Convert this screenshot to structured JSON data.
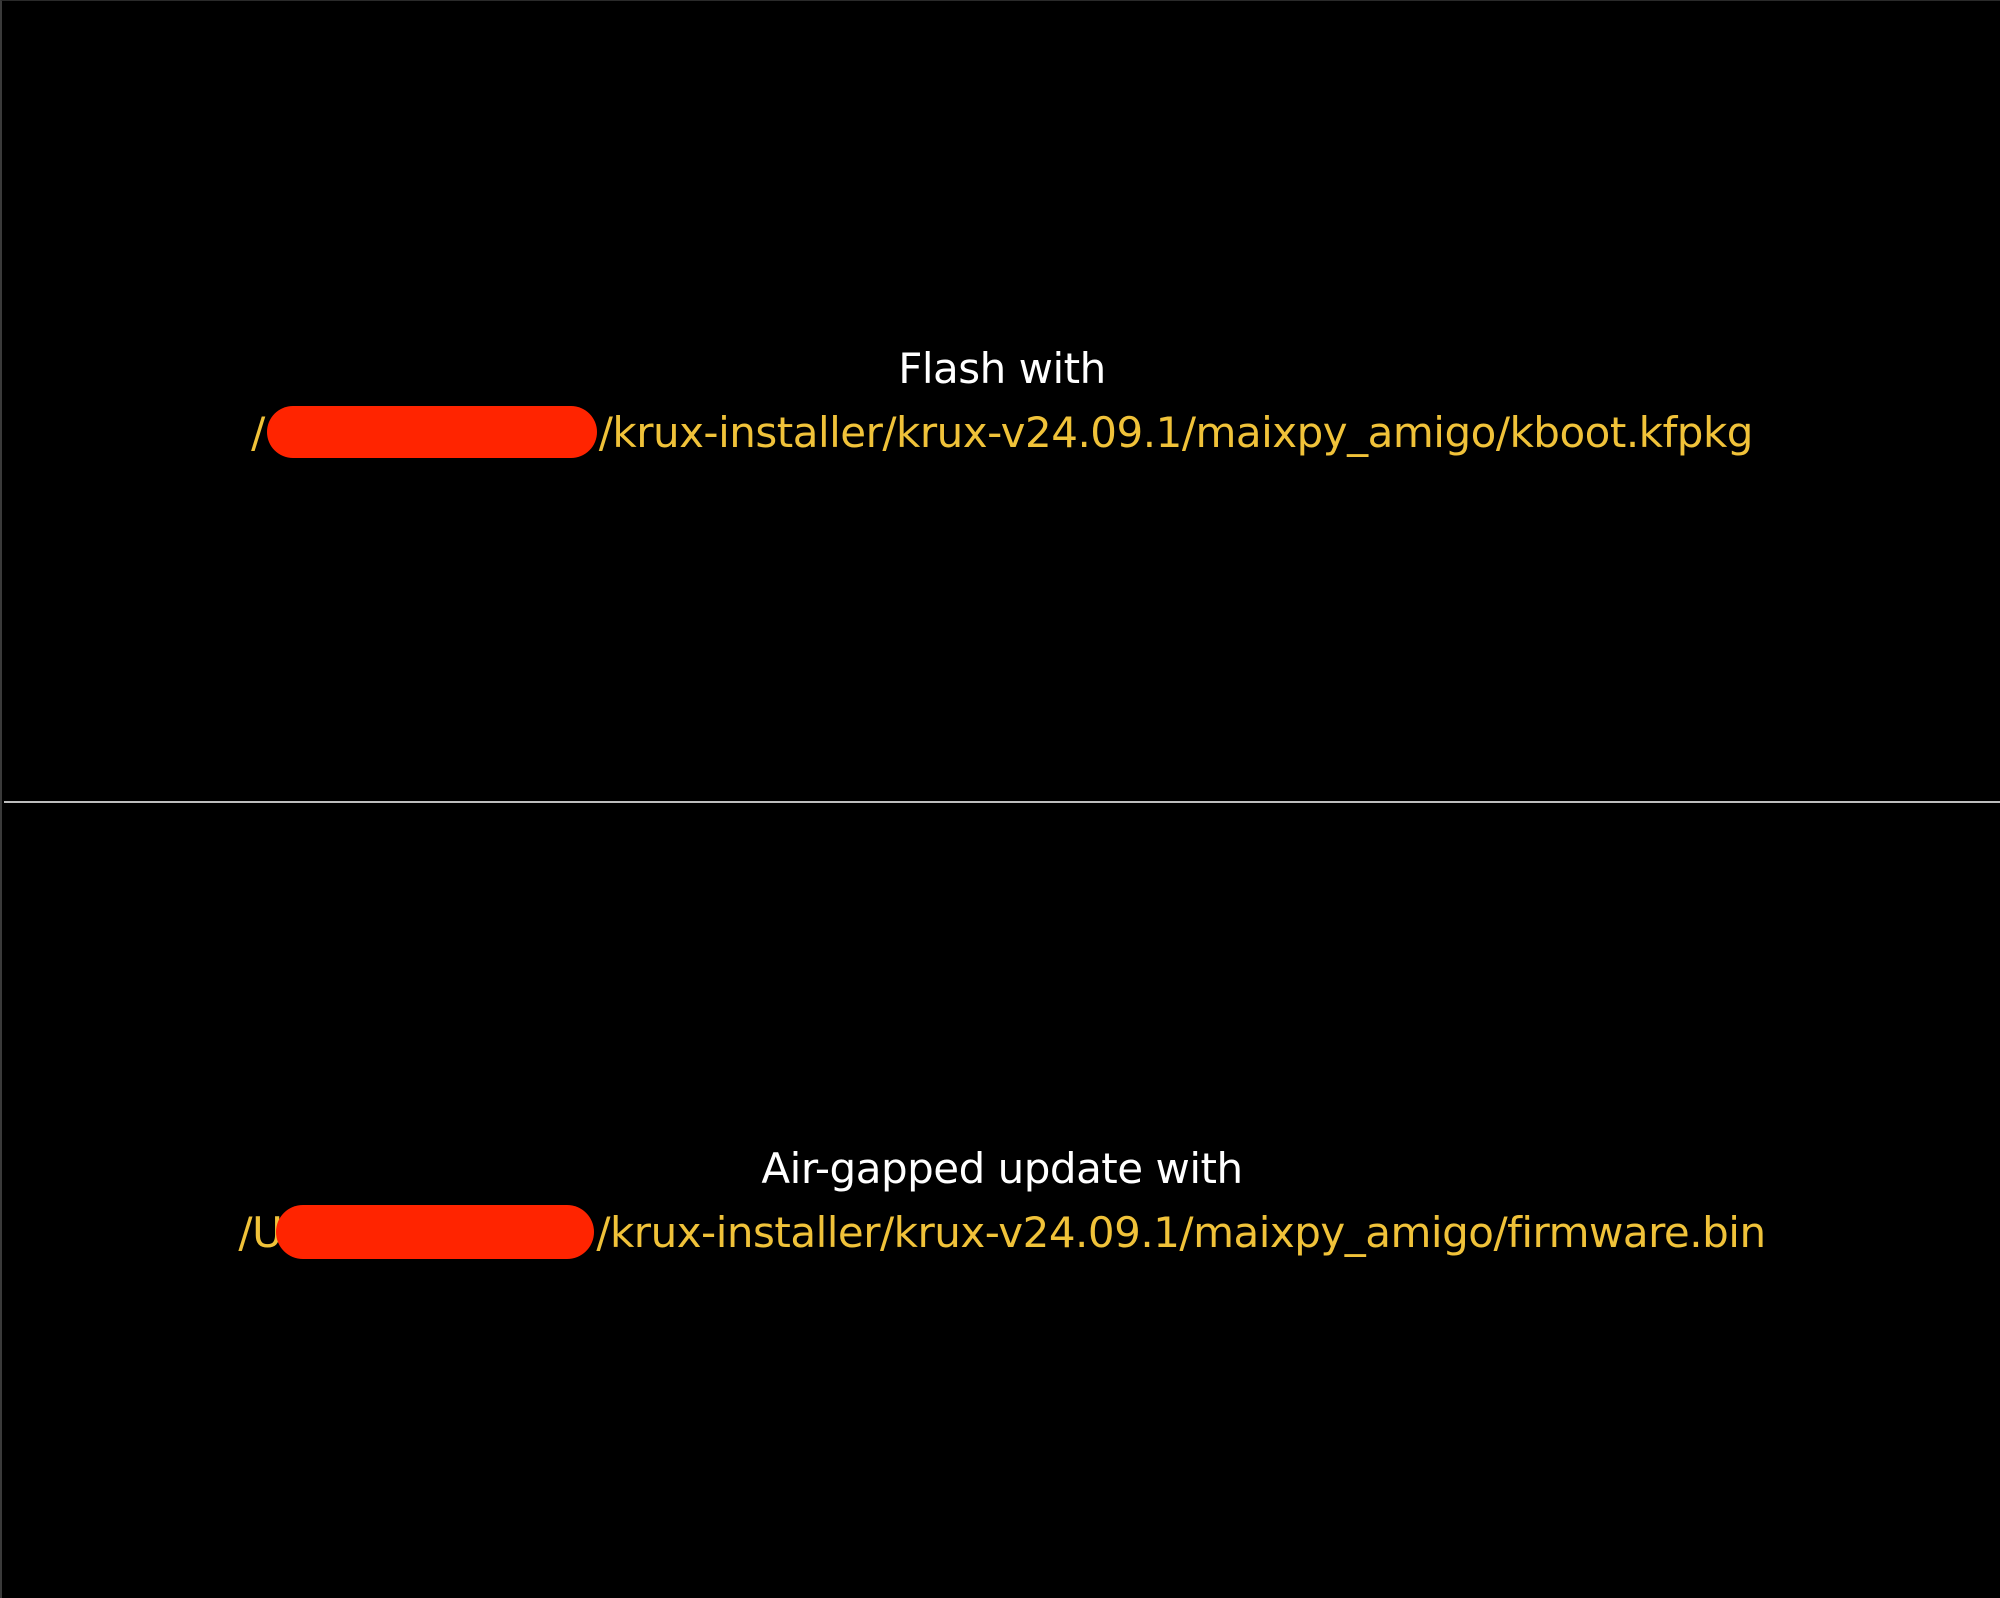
{
  "window": {
    "options": [
      {
        "label": "Flash with",
        "path_prefix": "/",
        "path_suffix": "/krux-installer/krux-v24.09.1/maixpy_amigo/kboot.kfpkg"
      },
      {
        "label": "Air-gapped update with",
        "path_prefix": "/U",
        "path_suffix": "/krux-installer/krux-v24.09.1/maixpy_amigo/firmware.bin"
      }
    ]
  },
  "colors": {
    "background": "#000000",
    "label_text": "#ffffff",
    "path_text": "#f0c239",
    "redaction": "#ff2400",
    "divider": "#bdbdbd"
  }
}
